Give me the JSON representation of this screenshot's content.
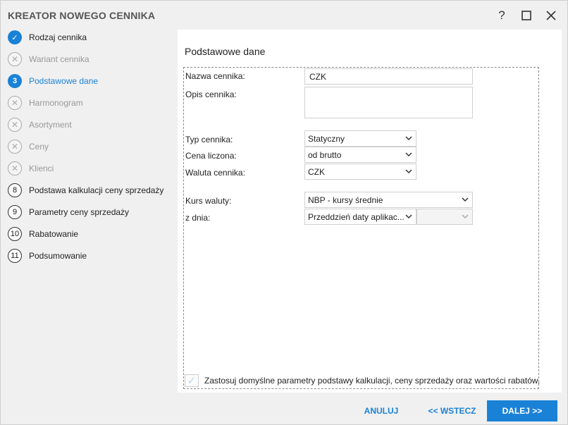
{
  "window": {
    "title": "KREATOR NOWEGO CENNIKA",
    "help_glyph": "?",
    "maximize_glyph": "☐",
    "close_glyph": "✕"
  },
  "steps": [
    {
      "marker": "✓",
      "label": "Rodzaj cennika",
      "state": "done"
    },
    {
      "marker": "✕",
      "label": "Wariant cennika",
      "state": "skipped"
    },
    {
      "marker": "3",
      "label": "Podstawowe dane",
      "state": "current"
    },
    {
      "marker": "✕",
      "label": "Harmonogram",
      "state": "skipped"
    },
    {
      "marker": "✕",
      "label": "Asortyment",
      "state": "skipped"
    },
    {
      "marker": "✕",
      "label": "Ceny",
      "state": "skipped"
    },
    {
      "marker": "✕",
      "label": "Klienci",
      "state": "skipped"
    },
    {
      "marker": "8",
      "label": "Podstawa kalkulacji ceny sprzedaży",
      "state": "todo"
    },
    {
      "marker": "9",
      "label": "Parametry ceny sprzedaży",
      "state": "todo"
    },
    {
      "marker": "10",
      "label": "Rabatowanie",
      "state": "todo"
    },
    {
      "marker": "11",
      "label": "Podsumowanie",
      "state": "todo"
    }
  ],
  "section": {
    "title": "Podstawowe dane"
  },
  "form": {
    "name_label": "Nazwa cennika:",
    "name_value": "CZK",
    "desc_label": "Opis cennika:",
    "desc_value": "",
    "type_label": "Typ cennika:",
    "type_value": "Statyczny",
    "price_label": "Cena liczona:",
    "price_value": "od brutto",
    "currency_label": "Waluta cennika:",
    "currency_value": "CZK",
    "rate_label": "Kurs waluty:",
    "rate_value": "NBP - kursy średnie",
    "date_label": "z dnia:",
    "date_value": "Przeddzień daty aplikac...",
    "date_extra_value": "",
    "chevron": "⌄"
  },
  "checkbox": {
    "checked": true,
    "mark": "✓",
    "label": "Zastosuj domyślne parametry podstawy kalkulacji, ceny sprzedaży oraz wartości rabatów."
  },
  "buttons": {
    "cancel": "ANULUJ",
    "back": "<< WSTECZ",
    "next": "DALEJ >>"
  },
  "colors": {
    "accent": "#1a82d6",
    "skipped": "#aaaaaa"
  },
  "icons": {
    "help": "help-icon",
    "maximize": "maximize-icon",
    "close": "close-icon",
    "done": "check-icon",
    "skipped": "cross-icon",
    "dropdown": "chevron-down-icon"
  }
}
